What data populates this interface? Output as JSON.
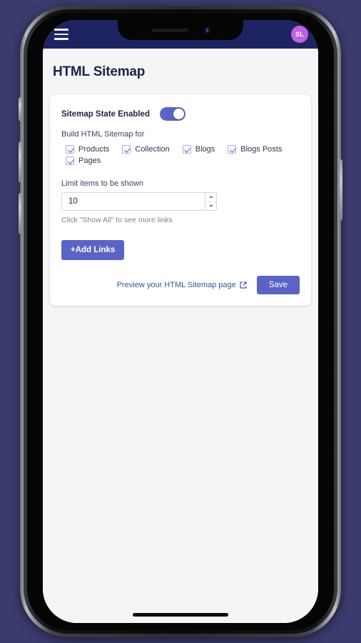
{
  "app": {
    "header": {
      "menu_icon": "hamburger-menu-icon",
      "avatar_initials": "SL",
      "bar_color": "#1e2362",
      "avatar_color": "#bb63e0"
    },
    "page_title": "HTML Sitemap",
    "accent_color": "#5b63c4",
    "background_color": "#3b3c6e",
    "content_background": "#f4f5f7"
  },
  "card": {
    "toggle": {
      "label": "Sitemap State Enabled",
      "state": "on"
    },
    "build_section": {
      "label": "Build HTML Sitemap for",
      "options": [
        {
          "label": "Products",
          "checked": true
        },
        {
          "label": "Collection",
          "checked": true
        },
        {
          "label": "Blogs",
          "checked": true
        },
        {
          "label": "Blogs Posts",
          "checked": true
        },
        {
          "label": "Pages",
          "checked": true
        }
      ]
    },
    "limit_field": {
      "label": "Limit items to be shown",
      "value": "10",
      "placeholder": "10",
      "hint": "Click \"Show All\" to see more links"
    },
    "add_links_label": "+Add Links",
    "preview_link_label": "Preview your HTML Sitemap page",
    "preview_link_icon": "external-link-icon",
    "save_label": "Save"
  }
}
